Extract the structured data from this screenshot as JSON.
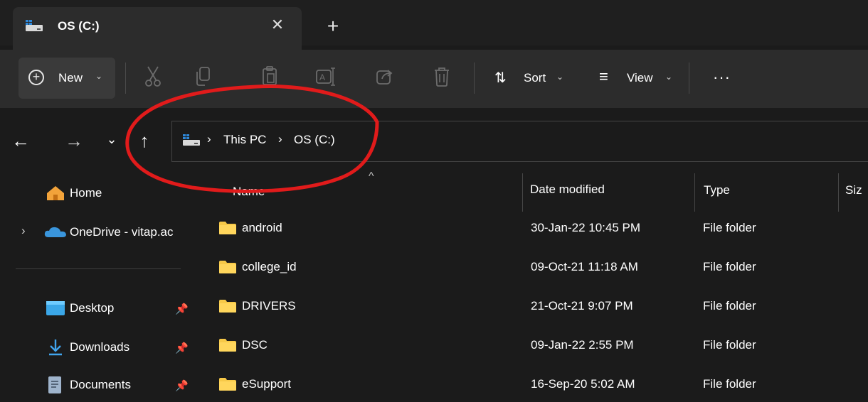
{
  "tab": {
    "title": "OS (C:)",
    "close_symbol": "✕",
    "new_tab_symbol": "+"
  },
  "toolbar": {
    "new_label": "New",
    "sort_label": "Sort",
    "view_label": "View",
    "more_label": "···",
    "icons": [
      "cut-icon",
      "copy-icon",
      "paste-icon",
      "rename-icon",
      "share-icon",
      "delete-icon"
    ]
  },
  "nav": {
    "back": "←",
    "forward": "→",
    "recent": "⌄",
    "up": "↑"
  },
  "address": {
    "segments": [
      "This PC",
      "OS (C:)"
    ],
    "separator": "›"
  },
  "sidebar": {
    "home": "Home",
    "onedrive": "OneDrive - vitap.ac",
    "expand_symbol": "›",
    "pinned": [
      {
        "label": "Desktop",
        "icon": "desktop-icon"
      },
      {
        "label": "Downloads",
        "icon": "download-icon"
      },
      {
        "label": "Documents",
        "icon": "documents-icon"
      }
    ]
  },
  "columns": {
    "name": "Name",
    "date": "Date modified",
    "type": "Type",
    "size": "Siz"
  },
  "rows": [
    {
      "name": "android",
      "date": "30-Jan-22 10:45 PM",
      "type": "File folder"
    },
    {
      "name": "college_id",
      "date": "09-Oct-21 11:18 AM",
      "type": "File folder"
    },
    {
      "name": "DRIVERS",
      "date": "21-Oct-21 9:07 PM",
      "type": "File folder"
    },
    {
      "name": "DSC",
      "date": "09-Jan-22 2:55 PM",
      "type": "File folder"
    },
    {
      "name": "eSupport",
      "date": "16-Sep-20 5:02 AM",
      "type": "File folder"
    }
  ],
  "colors": {
    "background": "#1b1b1b",
    "toolbar": "#2c2c2c",
    "folder": "#f7c948",
    "annotation": "#e11b1b",
    "onedrive": "#3a96dd"
  }
}
